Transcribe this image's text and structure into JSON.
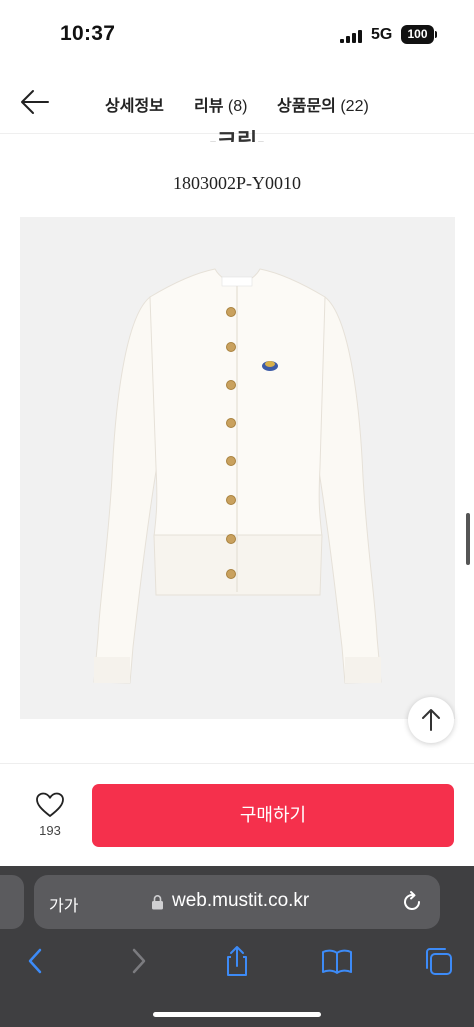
{
  "status_bar": {
    "time": "10:37",
    "network": "5G",
    "battery": "100"
  },
  "top_nav": {
    "tabs": [
      {
        "label": "상세정보",
        "count": ""
      },
      {
        "label": "리뷰",
        "count": "(8)"
      },
      {
        "label": "상품문의",
        "count": "(22)"
      }
    ]
  },
  "product": {
    "partial_heading": "-크림-",
    "code": "1803002P-Y0010",
    "image_icon": "cream-cardigan-photo"
  },
  "purchase_bar": {
    "like_count": "193",
    "buy_label": "구매하기",
    "buy_color": "#f5304c"
  },
  "browser": {
    "text_size_label": "가가",
    "url": "web.mustit.co.kr"
  },
  "colors": {
    "chrome_bg": "#3f3f41",
    "address_bg": "#5b5b5e",
    "toolbar_icon": "#3d8bf7",
    "image_bg": "#f1f1f1"
  }
}
